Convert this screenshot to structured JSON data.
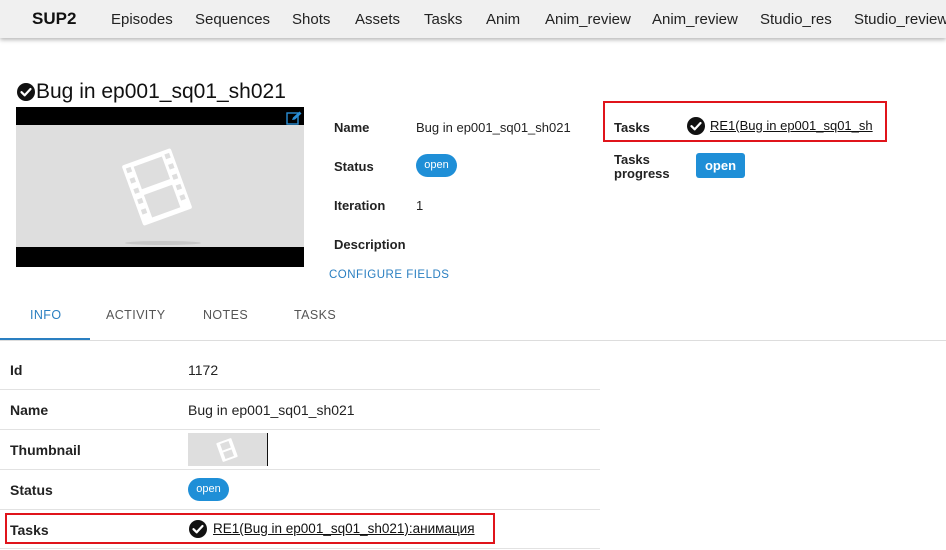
{
  "nav": {
    "brand": "SUP2",
    "items": [
      "Episodes",
      "Sequences",
      "Shots",
      "Assets",
      "Tasks",
      "Anim",
      "Anim_review",
      "Anim_review",
      "Studio_res",
      "Studio_review"
    ]
  },
  "header": {
    "title": "Bug in ep001_sq01_sh021"
  },
  "fields": {
    "name_label": "Name",
    "name_value": "Bug in ep001_sq01_sh021",
    "status_label": "Status",
    "status_value": "open",
    "iteration_label": "Iteration",
    "iteration_value": "1",
    "description_label": "Description",
    "configure": "CONFIGURE FIELDS",
    "tasks_label": "Tasks",
    "tasks_link": "RE1(Bug in ep001_sq01_sh",
    "progress_label_1": "Tasks",
    "progress_label_2": "progress",
    "progress_value": "open"
  },
  "tabs": [
    "INFO",
    "ACTIVITY",
    "NOTES",
    "TASKS"
  ],
  "info_table": {
    "id_label": "Id",
    "id_value": "1172",
    "name_label": "Name",
    "name_value": "Bug in ep001_sq01_sh021",
    "thumbnail_label": "Thumbnail",
    "status_label": "Status",
    "status_value": "open",
    "tasks_label": "Tasks",
    "tasks_value": "RE1(Bug in ep001_sq01_sh021):анимация"
  },
  "colors": {
    "accent": "#1f8fd7",
    "link_blue": "#2a7fc1",
    "highlight_red": "#e0141b"
  }
}
